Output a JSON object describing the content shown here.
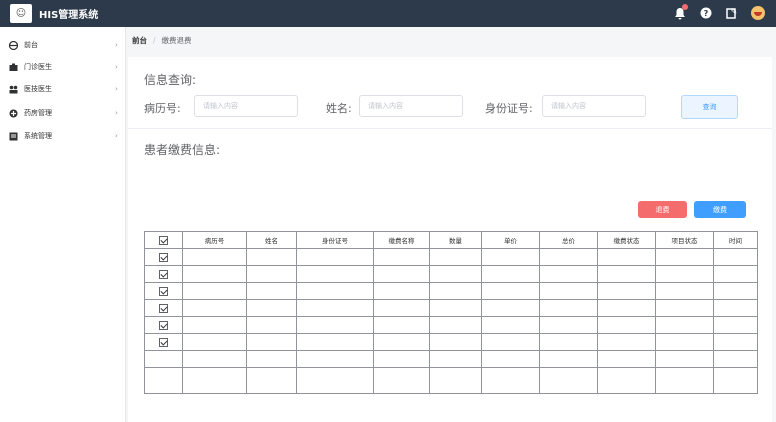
{
  "app": {
    "title": "HIS管理系统",
    "logo_glyph": "☺"
  },
  "topbar": {
    "icons": [
      "bell-icon",
      "help-icon",
      "edit-icon",
      "user-avatar-icon"
    ],
    "help_glyph": "?",
    "edit_glyph": "✎",
    "notification_color": "#f56c6c"
  },
  "sidebar": {
    "items": [
      {
        "label": "前台",
        "icon": "front-desk-icon",
        "chevron": "›"
      },
      {
        "label": "门诊医生",
        "icon": "outpatient-icon",
        "chevron": "›"
      },
      {
        "label": "医技医生",
        "icon": "medtech-icon",
        "chevron": "›"
      },
      {
        "label": "药房管理",
        "icon": "pharmacy-icon",
        "chevron": "›"
      },
      {
        "label": "系统管理",
        "icon": "system-icon",
        "chevron": "›"
      }
    ]
  },
  "breadcrumb": {
    "first": "前台",
    "separator": "/",
    "second": "缴费退费"
  },
  "query": {
    "title": "信息查询:",
    "record_label": "病历号:",
    "record_placeholder": "请输入内容",
    "name_label": "姓名:",
    "name_placeholder": "请输入内容",
    "id_label": "身份证号:",
    "id_placeholder": "请输入内容",
    "query_button": "查询"
  },
  "payment": {
    "title": "患者缴费信息:",
    "refund_button": "退费",
    "pay_button": "缴费",
    "columns": [
      "病历号",
      "姓名",
      "身份证号",
      "缴费名称",
      "数量",
      "单价",
      "总价",
      "缴费状态",
      "项目状态",
      "时间"
    ],
    "rows_with_checkbox": 6,
    "empty_rows": 2
  },
  "colors": {
    "topbar": "#2d3a4b",
    "primary": "#409eff",
    "danger": "#f56c6c"
  }
}
